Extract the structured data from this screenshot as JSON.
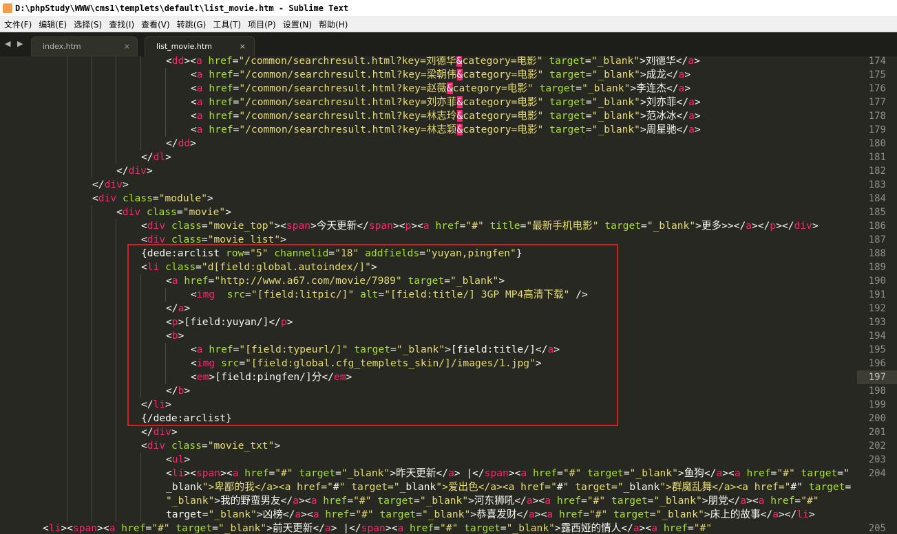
{
  "window": {
    "title": "D:\\phpStudy\\WWW\\cms1\\templets\\default\\list_movie.htm - Sublime Text"
  },
  "menu": {
    "items": [
      "文件(F)",
      "编辑(E)",
      "选择(S)",
      "查找(I)",
      "查看(V)",
      "转跳(G)",
      "工具(T)",
      "项目(P)",
      "设置(N)",
      "帮助(H)"
    ]
  },
  "tabs": [
    {
      "label": "index.htm",
      "close": "×",
      "active": false
    },
    {
      "label": "list_movie.htm",
      "close": "×",
      "active": true
    }
  ],
  "nav": {
    "arrows": "◀ ▶"
  },
  "editor": {
    "current_line": "197",
    "highlight_box_color": "#d81e1e",
    "theme_colors": {
      "background": "#272822",
      "tag": "#f92672",
      "attribute": "#a6e22e",
      "string": "#e6db74",
      "text": "#f8f8f2"
    },
    "lines": [
      {
        "n": "174",
        "code": "<dd><a href=\"/common/searchresult.html?key=刘德华&category=电影\" target=\"_blank\">刘德华</a>"
      },
      {
        "n": "175",
        "code": "<a href=\"/common/searchresult.html?key=梁朝伟&category=电影\" target=\"_blank\">成龙</a>"
      },
      {
        "n": "176",
        "code": "<a href=\"/common/searchresult.html?key=赵薇&category=电影\" target=\"_blank\">李连杰</a>"
      },
      {
        "n": "177",
        "code": "<a href=\"/common/searchresult.html?key=刘亦菲&category=电影\" target=\"_blank\">刘亦菲</a>"
      },
      {
        "n": "178",
        "code": "<a href=\"/common/searchresult.html?key=林志玲&category=电影\" target=\"_blank\">范冰冰</a>"
      },
      {
        "n": "179",
        "code": "<a href=\"/common/searchresult.html?key=林志颖&category=电影\" target=\"_blank\">周星驰</a>"
      },
      {
        "n": "180",
        "code": "</dd>"
      },
      {
        "n": "181",
        "code": "</dl>"
      },
      {
        "n": "182",
        "code": "</div>"
      },
      {
        "n": "183",
        "code": "</div>"
      },
      {
        "n": "184",
        "code": "<div class=\"module\">"
      },
      {
        "n": "185",
        "code": "<div class=\"movie\">"
      },
      {
        "n": "186",
        "code": "<div class=\"movie_top\"><span>今天更新</span><p><a href=\"#\" title=\"最新手机电影\" target=\"_blank\">更多>></a></p></div>"
      },
      {
        "n": "187",
        "code": "<div class=\"movie_list\">"
      },
      {
        "n": "188",
        "code": "{dede:arclist row=\"5\" channelid=\"18\" addfields=\"yuyan,pingfen\"}"
      },
      {
        "n": "189",
        "code": "<li class=\"d[field:global.autoindex/]\">"
      },
      {
        "n": "190",
        "code": "<a href=\"http://www.a67.com/movie/7989\" target=\"_blank\">"
      },
      {
        "n": "191",
        "code": "<img  src=\"[field:litpic/]\" alt=\"[field:title/] 3GP MP4高清下载\" />"
      },
      {
        "n": "192",
        "code": "</a>"
      },
      {
        "n": "193",
        "code": "<p>[field:yuyan/]</p>"
      },
      {
        "n": "194",
        "code": "<b>"
      },
      {
        "n": "195",
        "code": "<a href=\"[field:typeurl/]\" target=\"_blank\">[field:title/]</a>"
      },
      {
        "n": "196",
        "code": "<img src=\"[field:global.cfg_templets_skin/]/images/1.jpg\">"
      },
      {
        "n": "197",
        "code": "<em>[field:pingfen/]分</em>"
      },
      {
        "n": "198",
        "code": "</b>"
      },
      {
        "n": "199",
        "code": "</li>"
      },
      {
        "n": "200",
        "code": "{/dede:arclist}"
      },
      {
        "n": "201",
        "code": "</div>"
      },
      {
        "n": "202",
        "code": "<div class=\"movie_txt\">"
      },
      {
        "n": "203",
        "code": "<ul>"
      },
      {
        "n": "204",
        "code": "<li><span><a href=\"#\" target=\"_blank\">昨天更新</a> |</span><a href=\"#\" target=\"_blank\">鱼狗</a><a href=\"#\" target=\""
      },
      {
        "n": "",
        "code": "_blank\">卑鄙的我</a><a href=\"#\" target=\"_blank\">爱出色</a><a href=\"#\" target=\"_blank\">群魔乱舞</a><a href=\"#\" target="
      },
      {
        "n": "",
        "code": "\"_blank\">我的野蛮男友</a><a href=\"#\" target=\"_blank\">河东狮吼</a><a href=\"#\" target=\"_blank\">朋党</a><a href=\"#\""
      },
      {
        "n": "",
        "code": "target=\"_blank\">凶榜</a><a href=\"#\" target=\"_blank\">恭喜发财</a><a href=\"#\" target=\"_blank\">床上的故事</a></li>"
      },
      {
        "n": "205",
        "code": "<li><span><a href=\"#\" target=\"_blank\">前天更新</a> |</span><a href=\"#\" target=\"_blank\">露西娅的情人</a><a href=\"#\""
      }
    ]
  }
}
